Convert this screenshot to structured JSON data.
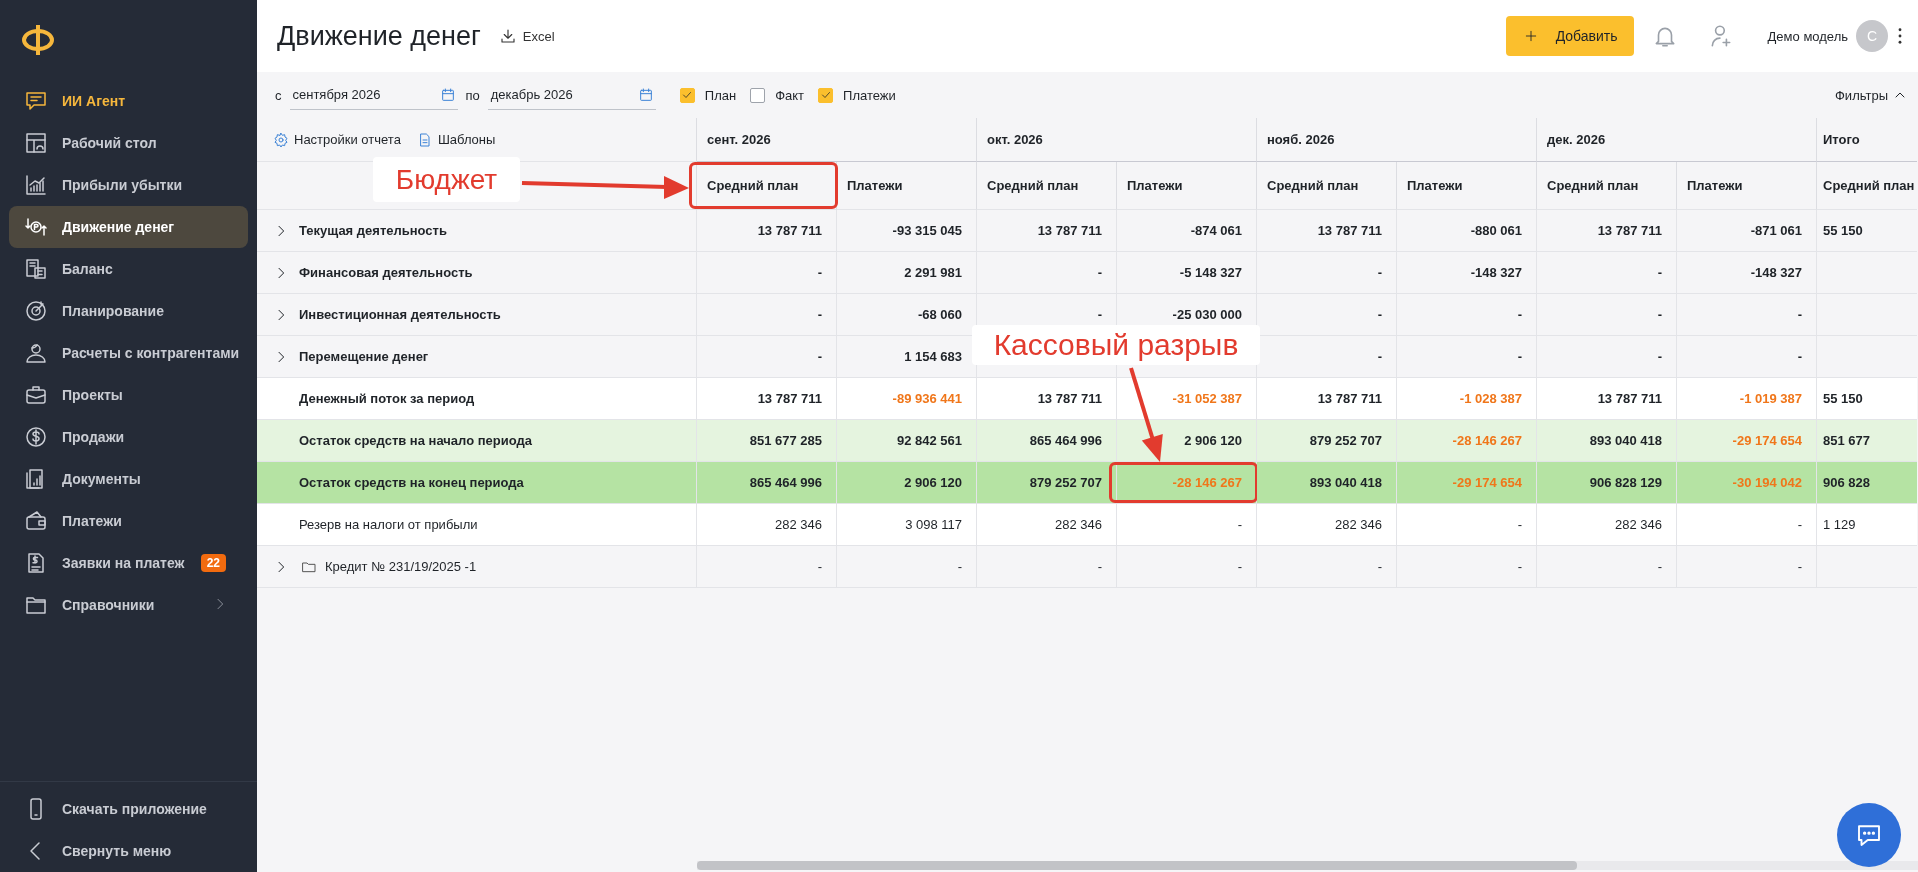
{
  "sidebar": {
    "items": [
      {
        "label": "ИИ Агент",
        "selected": false,
        "accent": true
      },
      {
        "label": "Рабочий стол",
        "selected": false,
        "accent": false
      },
      {
        "label": "Прибыли убытки",
        "selected": false,
        "accent": false
      },
      {
        "label": "Движение денег",
        "selected": true,
        "accent": false
      },
      {
        "label": "Баланс",
        "selected": false,
        "accent": false
      },
      {
        "label": "Планирование",
        "selected": false,
        "accent": false
      },
      {
        "label": "Расчеты с контрагентами",
        "selected": false,
        "accent": false
      },
      {
        "label": "Проекты",
        "selected": false,
        "accent": false
      },
      {
        "label": "Продажи",
        "selected": false,
        "accent": false
      },
      {
        "label": "Документы",
        "selected": false,
        "accent": false
      },
      {
        "label": "Платежи",
        "selected": false,
        "accent": false
      },
      {
        "label": "Заявки на платеж",
        "selected": false,
        "accent": false,
        "badge": "22"
      },
      {
        "label": "Справочники",
        "selected": false,
        "accent": false,
        "submenu": true
      }
    ],
    "footer_items": [
      {
        "label": "Скачать приложение"
      },
      {
        "label": "Свернуть меню"
      }
    ]
  },
  "header": {
    "title": "Движение денег",
    "export": "Excel",
    "add_button": "Добавить",
    "user": "Демо модель",
    "avatar": "С"
  },
  "filters": {
    "from_label": "с",
    "from": "сентября 2026",
    "to_label": "по",
    "to": "декабрь 2026",
    "toggles": [
      {
        "label": "План",
        "checked": true
      },
      {
        "label": "Факт",
        "checked": false
      },
      {
        "label": "Платежи",
        "checked": true
      }
    ],
    "filters_button": "Фильтры",
    "expanded": true
  },
  "report": {
    "links": [
      "Настройки отчета",
      "Шаблоны"
    ],
    "periods": [
      {
        "label": "сент. 2026",
        "columns": [
          {
            "label": "Средний план",
            "framed": true
          },
          {
            "label": "Платежи",
            "framed": false
          }
        ]
      },
      {
        "label": "окт. 2026",
        "columns": [
          {
            "label": "Средний план",
            "framed": false
          },
          {
            "label": "Платежи",
            "framed": false
          }
        ]
      },
      {
        "label": "нояб. 2026",
        "columns": [
          {
            "label": "Средний план",
            "framed": false
          },
          {
            "label": "Платежи",
            "framed": false
          }
        ]
      },
      {
        "label": "дек. 2026",
        "columns": [
          {
            "label": "Средний план",
            "framed": false
          },
          {
            "label": "Платежи",
            "framed": false
          }
        ]
      },
      {
        "label": "Итого",
        "columns": [
          {
            "label": "Средний план",
            "framed": false
          }
        ]
      }
    ],
    "rows": [
      {
        "kind": "group",
        "label": "Текущая деятельность",
        "expanded": false,
        "cells": [
          "13 787 711",
          "-93 315 045",
          "13 787 711",
          "-874 061",
          "13 787 711",
          "-880 061",
          "13 787 711",
          "-871 061",
          "55 150"
        ]
      },
      {
        "kind": "group",
        "label": "Финансовая деятельность",
        "expanded": false,
        "cells": [
          "-",
          "2 291 981",
          "-",
          "-5 148 327",
          "-",
          "-148 327",
          "-",
          "-148 327",
          null
        ]
      },
      {
        "kind": "group",
        "label": "Инвестиционная деятельность",
        "expanded": false,
        "cells": [
          "-",
          "-68 060",
          "-",
          "-25 030 000",
          "-",
          "-",
          "-",
          "-",
          null
        ]
      },
      {
        "kind": "group",
        "label": "Перемещение денег",
        "expanded": false,
        "cells": [
          "-",
          "1 154 683",
          null,
          null,
          "-",
          "-",
          "-",
          "-",
          null
        ]
      },
      {
        "kind": "total",
        "label": "Денежный поток за период",
        "cells": [
          "13 787 711",
          {
            "text": "-89 936 441",
            "alert": true
          },
          "13 787 711",
          {
            "text": "-31 052 387",
            "alert": true
          },
          "13 787 711",
          {
            "text": "-1 028 387",
            "alert": true
          },
          "13 787 711",
          {
            "text": "-1 019 387",
            "alert": true
          },
          "55 150"
        ]
      },
      {
        "kind": "start",
        "label": "Остаток средств на начало периода",
        "cells": [
          "851 677 285",
          "92 842 561",
          "865 464 996",
          "2 906 120",
          "879 252 707",
          {
            "text": "-28 146 267",
            "alert": true
          },
          "893 040 418",
          {
            "text": "-29 174 654",
            "alert": true
          },
          "851 677"
        ]
      },
      {
        "kind": "end",
        "label": "Остаток средств на конец периода",
        "cells": [
          "865 464 996",
          "2 906 120",
          "879 252 707",
          {
            "text": "-28 146 267",
            "alert": true,
            "framed": true
          },
          "893 040 418",
          {
            "text": "-29 174 654",
            "alert": true
          },
          "906 828 129",
          {
            "text": "-30 194 042",
            "alert": true
          },
          "906 828"
        ]
      },
      {
        "kind": "plain",
        "label": "Резерв на налоги от прибыли",
        "cells": [
          "282 346",
          "3 098 117",
          "282 346",
          "-",
          "282 346",
          "-",
          "282 346",
          "-",
          "1 129"
        ]
      },
      {
        "kind": "folder",
        "label": "Кредит № 231/19/2025 -1",
        "expanded": false,
        "cells": [
          "-",
          "-",
          "-",
          "-",
          "-",
          "-",
          "-",
          "-",
          null
        ]
      }
    ]
  },
  "annotations": [
    {
      "text": "Бюджет"
    },
    {
      "text": "Кассовый разрыв"
    }
  ]
}
